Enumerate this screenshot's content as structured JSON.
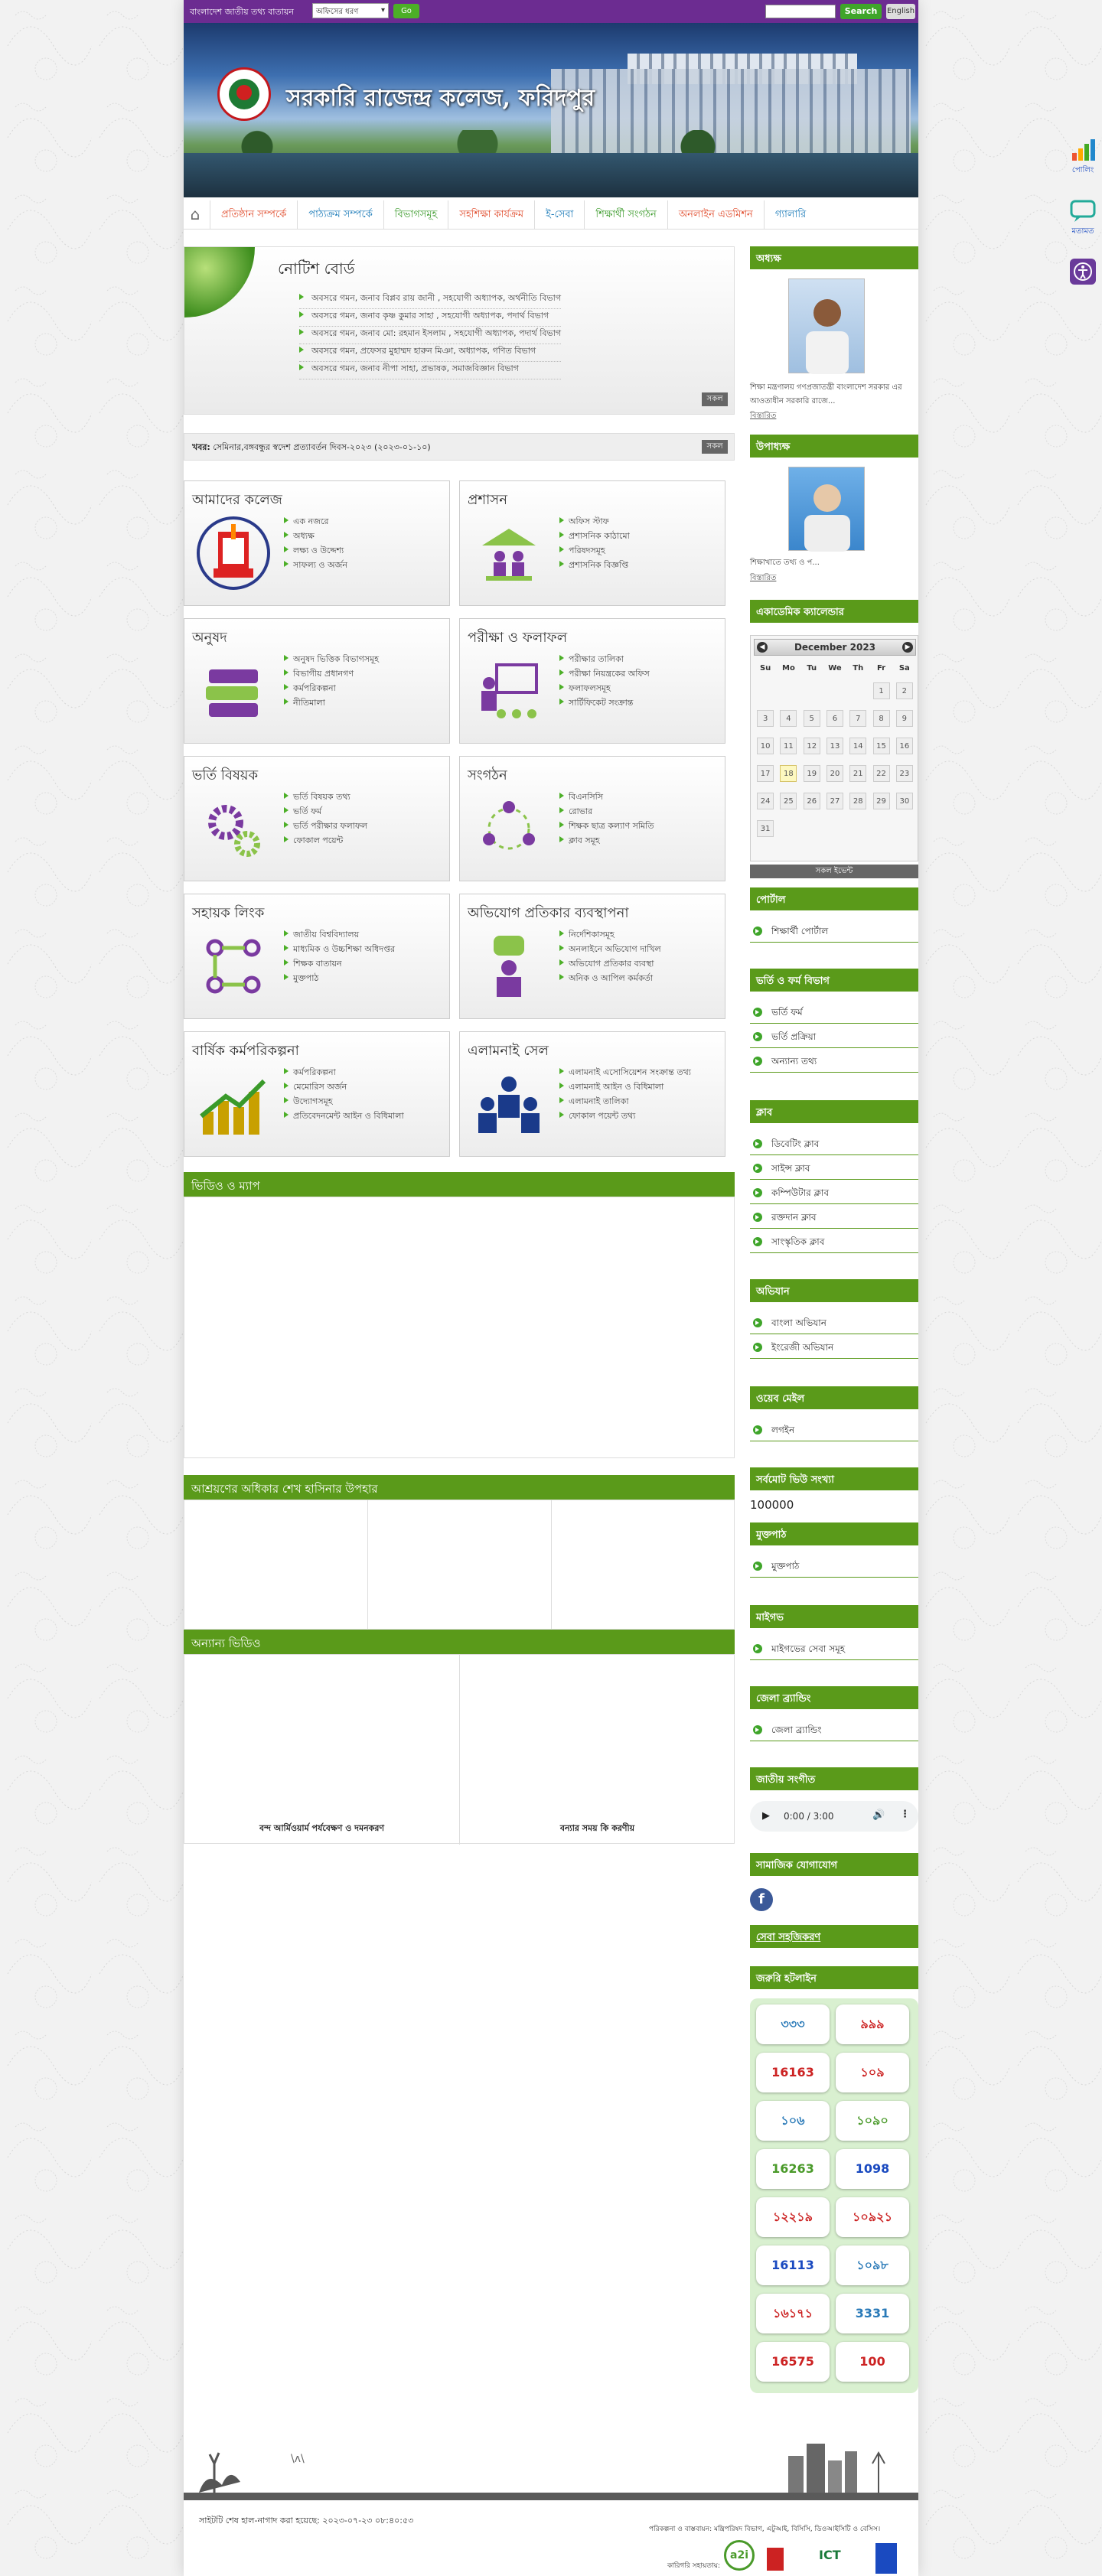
{
  "topbar": {
    "portal_label": "বাংলাদেশ জাতীয় তথ্য বাতায়ন",
    "office_select": "অফিসের ধরণ",
    "go": "Go",
    "search": "Search",
    "english": "English"
  },
  "banner": {
    "title": "সরকারি রাজেন্দ্র কলেজ, ফরিদপুর"
  },
  "nav": [
    "প্রতিষ্ঠান সম্পর্কে",
    "পাঠ্যক্রম সম্পর্কে",
    "বিভাগসমূহ",
    "সহশিক্ষা কার্যক্রম",
    "ই-সেবা",
    "শিক্ষার্থী সংগঠন",
    "অনলাইন এডমিশন",
    "গ্যালারি"
  ],
  "notice": {
    "title": "নোটিশ বোর্ড",
    "items": [
      "অবসরে গমন, জনাব বিপ্লব রায় জানী , সহযোগী অধ্যাপক, অর্থনীতি বিভাগ",
      "অবসরে গমন, জনাব কৃষ্ণ কুমার সাহা , সহযোগী অধ্যাপক, পদার্থ বিভাগ",
      "অবসরে গমন, জনাব মো: রহমান ইসলাম , সহযোগী অধ্যাপক, পদার্থ বিভাগ",
      "অবসরে গমন, প্রফেসর মুহাম্মদ হারুন মিঞা, অধ্যাপক, গণিত বিভাগ",
      "অবসরে গমন, জনাব নীপা সাহা, প্রভাষক, সমাজবিজ্ঞান বিভাগ"
    ],
    "all": "সকল"
  },
  "news": {
    "label": "খবর:",
    "text": "সেমিনার,বঙ্গবন্ধুর স্বদেশ প্রত্যাবর্তন দিবস-২০২৩ (২০২৩-০১-১০)",
    "all": "সকল"
  },
  "boxes": [
    {
      "title": "আমাদের কলেজ",
      "items": [
        "এক নজরে",
        "অধ্যক্ষ",
        "লক্ষ্য ও উদ্দেশ্য",
        "সাফল্য ও অর্জন"
      ]
    },
    {
      "title": "প্রশাসন",
      "items": [
        "অফিস স্টাফ",
        "প্রশাসনিক কাঠামো",
        "পরিষদসমূহ",
        "প্রশাসনিক বিজ্ঞপ্তি"
      ]
    },
    {
      "title": "অনুষদ",
      "items": [
        "অনুষদ ভিত্তিক বিভাগসমূহ",
        "বিভাগীয় প্রধানগণ",
        "কর্মপরিকল্পনা",
        "নীতিমালা"
      ]
    },
    {
      "title": "পরীক্ষা ও ফলাফল",
      "items": [
        "পরীক্ষার তালিকা",
        "পরীক্ষা নিয়ন্ত্রকের অফিস",
        "ফলাফলসমূহ",
        "সার্টিফিকেট সংক্রান্ত"
      ]
    },
    {
      "title": "ভর্তি বিষয়ক",
      "items": [
        "ভর্তি বিষয়ক তথ্য",
        "ভর্তি ফর্ম",
        "ভর্তি পরীক্ষার ফলাফল",
        "ফোকাল পয়েন্ট"
      ]
    },
    {
      "title": "সংগঠন",
      "items": [
        "বিএনসিসি",
        "রোভার",
        "শিক্ষক ছাত্র কল্যাণ সমিতি",
        "ক্লাব সমূহ"
      ]
    },
    {
      "title": "সহায়ক লিংক",
      "items": [
        "জাতীয় বিশ্ববিদ্যালয়",
        "মাধ্যমিক ও উচ্চশিক্ষা অধিদপ্তর",
        "শিক্ষক বাতায়ন",
        "মুক্তপাঠ"
      ]
    },
    {
      "title": "অভিযোগ প্রতিকার ব্যবস্থাপনা",
      "items": [
        "নির্দেশিকাসমূহ",
        "অনলাইনে অভিযোগ দাখিল",
        "অভিযোগ প্রতিকার ব্যবস্থা",
        "অনিক ও আপিল কর্মকর্তা"
      ]
    },
    {
      "title": "বার্ষিক কর্মপরিকল্পনা",
      "items": [
        "কর্মপরিকল্পনা",
        "মেমোরিস অর্জন",
        "উদ্যোগসমূহ",
        "প্রতিবেদনমেন্ট আইন ও বিধিমালা"
      ]
    },
    {
      "title": "এলামনাই সেল",
      "items": [
        "এলামনাই এসোসিয়েশন সংক্রান্ত তথ্য",
        "এলামনাই আইন ও বিধিমালা",
        "এলামনাই তালিকা",
        "ফোকাল পয়েন্ট তথ্য"
      ]
    }
  ],
  "sections": {
    "video_map": "ভিডিও ও ম্যাপ",
    "hasina": "আশ্রয়ণের অধিকার শেখ হাসিনার উপহার",
    "other_video": "অন্যান্য ভিডিও",
    "video1": "বন্দ আর্মিওয়ার্ম পর্যবেক্ষণ ও দমনকরণ",
    "video2": "বন্যার সময় কি করণীয়"
  },
  "sidebar": {
    "principal_h": "অধ্যক্ষ",
    "principal_text": "শিক্ষা মন্ত্রণালয় গণপ্রজাতন্ত্রী বাংলাদেশ সরকার এর আওতাধীন সরকারি রাজে...",
    "details": "বিস্তারিত",
    "vice_h": "উপাধ্যক্ষ",
    "vice_text": "শিক্ষাখাতে তথ্য ও প...",
    "details2": "বিস্তারিত",
    "cal_h": "একাডেমিক ক্যালেন্ডার",
    "cal_month": "December 2023",
    "cal_days": [
      "Su",
      "Mo",
      "Tu",
      "We",
      "Th",
      "Fr",
      "Sa"
    ],
    "cal_all": "সকল ইভেন্ট",
    "portal_h": "পোর্টাল",
    "portal_items": [
      "শিক্ষার্থী পোর্টাল"
    ],
    "admit_h": "ভর্তি ও ফর্ম বিভাগ",
    "admit_items": [
      "ভর্তি ফর্ম",
      "ভর্তি প্রক্রিয়া",
      "অন্যান্য তথ্য"
    ],
    "club_h": "ক্লাব",
    "club_items": [
      "ডিবেটিং ক্লাব",
      "সাইন্স ক্লাব",
      "কম্পিউটার ক্লাব",
      "রক্তদান ক্লাব",
      "সাংস্কৃতিক ক্লাব"
    ],
    "ferry_h": "অভিযান",
    "ferry_items": [
      "বাংলা অভিযান",
      "ইংরেজী অভিযান"
    ],
    "mail_h": "ওয়েব মেইল",
    "mail_items": [
      "লগইন"
    ],
    "visit_h": "সর্বমোট ভিউ সংখ্যা",
    "visit_count": "100000",
    "free_h": "মুক্তপাঠ",
    "free_items": [
      "মুক্তপাঠ"
    ],
    "mygov_h": "মাইগভ",
    "mygov_items": [
      "মাইগভের সেবা সমূহ"
    ],
    "brand_h": "জেলা ব্র্যান্ডিং",
    "brand_items": [
      "জেলা ব্র্যান্ডিং"
    ],
    "anthem_h": "জাতীয় সংগীত",
    "anthem_time": "0:00 / 3:00",
    "social_h": "সামাজিক যোগাযোগ",
    "service_h": "সেবা সহজিকরণ",
    "hotline_h": "জরুরি হটলাইন",
    "hotlines": [
      "৩৩৩",
      "৯৯৯",
      "16163",
      "১০৯",
      "১০৬",
      "১০৯০",
      "16263",
      "1098",
      "১২২১৯",
      "১০৯২১",
      "16113",
      "১০৯৮",
      "১৬১৭১",
      "3331",
      "16575",
      "100"
    ]
  },
  "right_icons": {
    "a": "পোলিং",
    "b": "মতামত"
  },
  "footer": {
    "updated": "সাইটটি শেষ হাল-নাগাদ করা হয়েছে: ২০২৩-০৭-২৩ ০৮:৪০:৫৩",
    "plan": "পরিকল্পনা ও বাস্তবায়ন:  মন্ত্রিপরিষদ বিভাগ, এটুআই, বিসিসি, ডিওআইসিটি ও বেসিস।",
    "tech": "কারিগরি সহায়তায়:"
  }
}
